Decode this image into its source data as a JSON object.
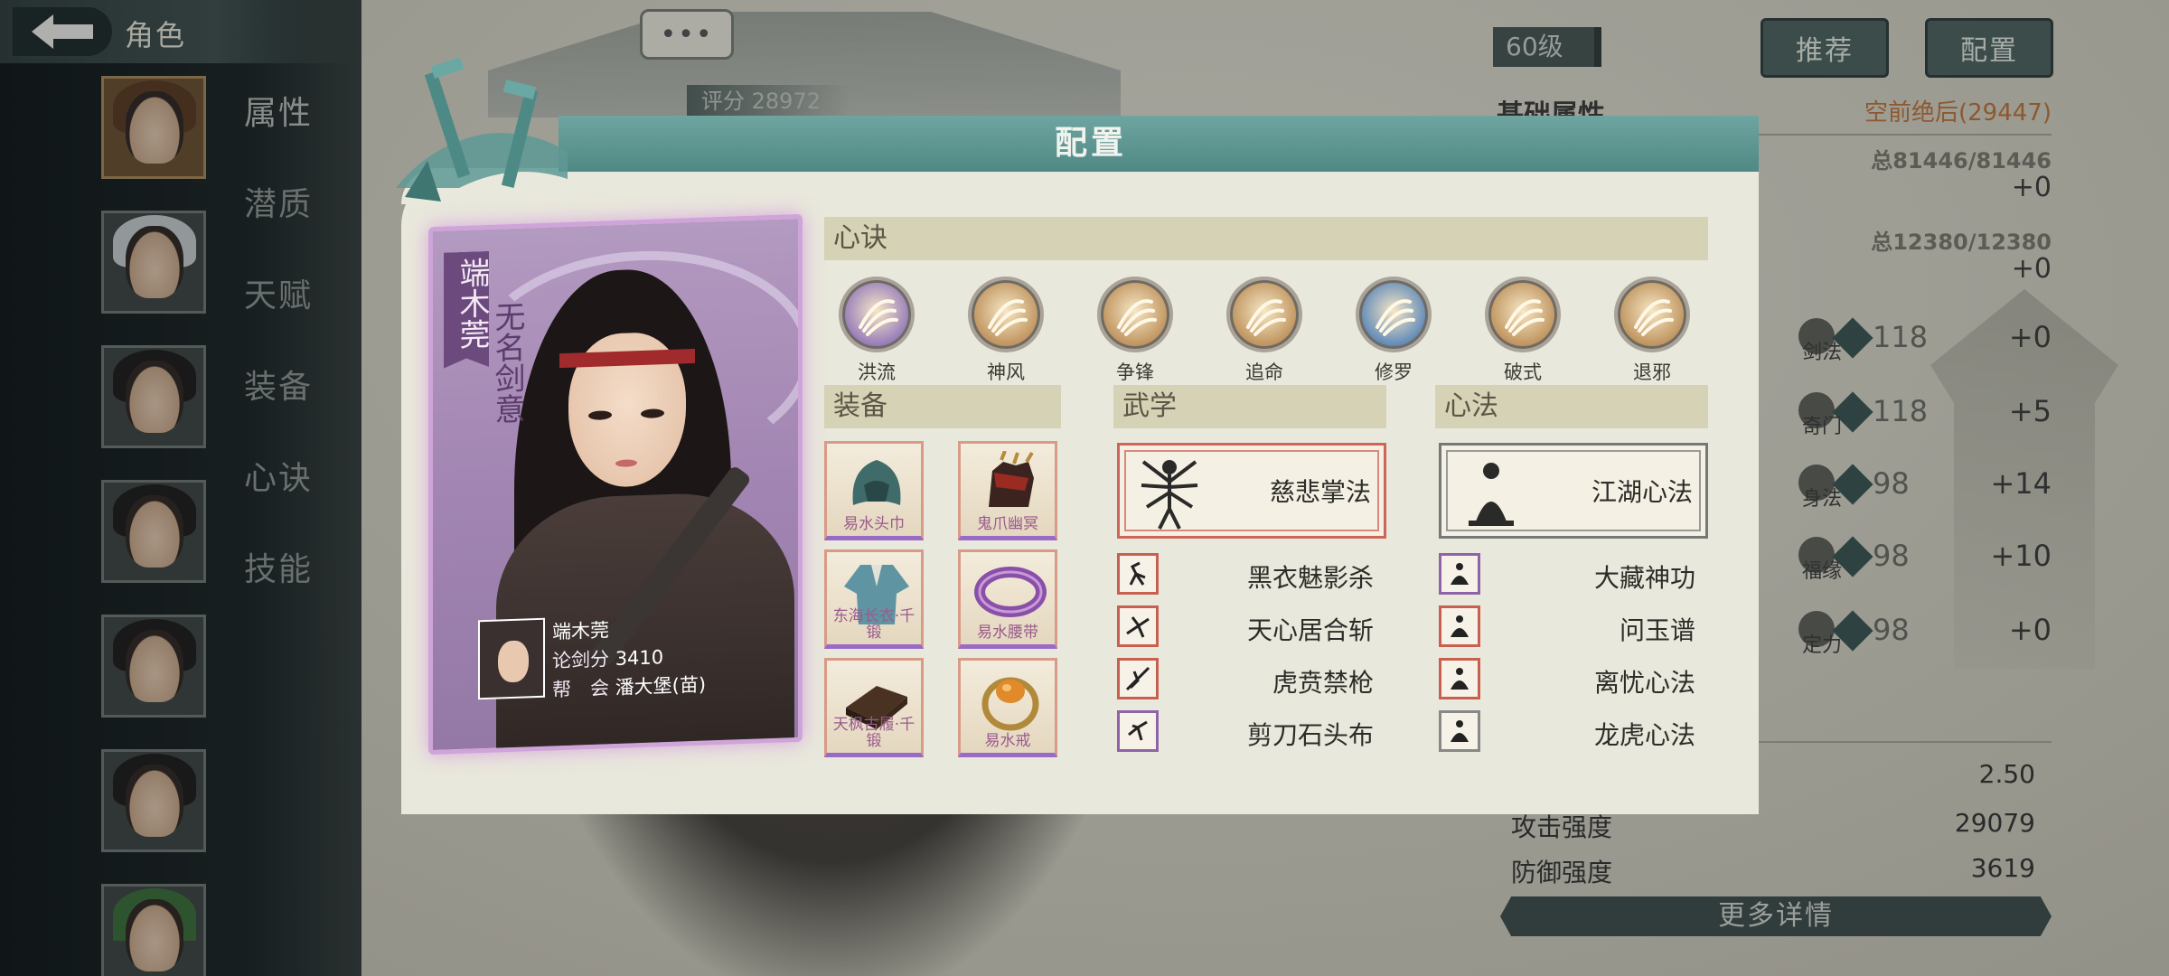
{
  "topbar": {
    "title": "角色"
  },
  "side_menu": [
    "属性",
    "潜质",
    "天赋",
    "装备",
    "心诀",
    "技能"
  ],
  "background": {
    "chat_bubble": "•••",
    "score_label": "评分",
    "score_value": "28972",
    "level": "60级",
    "recommend_button": "推荐",
    "config_button": "配置",
    "base_attr_title": "基础属性",
    "rating_text": "空前绝后(29447)",
    "hp_total": "总81446/81446",
    "hp_plus": "+0",
    "mp_total": "总12380/12380",
    "mp_plus": "+0",
    "stats": [
      {
        "label": "剑法",
        "value": "118",
        "delta": "+0"
      },
      {
        "label": "奇门",
        "value": "118",
        "delta": "+5"
      },
      {
        "label": "身法",
        "value": "98",
        "delta": "+14"
      },
      {
        "label": "福缘",
        "value": "98",
        "delta": "+10"
      },
      {
        "label": "定力",
        "value": "98",
        "delta": "+0"
      }
    ],
    "crit_value": "2.50",
    "attack_label": "攻击强度",
    "attack_value": "29079",
    "defense_label": "防御强度",
    "defense_value": "3619",
    "more_details": "更多详情"
  },
  "modal": {
    "title": "配置",
    "card": {
      "name": "端木莞",
      "title": "无名剑意",
      "info_name": "端木莞",
      "score_label": "论剑分",
      "score_value": "3410",
      "guild_label": "帮　会",
      "guild_value": "潘大堡(苗)"
    },
    "xinjue": {
      "header": "心诀",
      "items": [
        {
          "label": "洪流",
          "icon": "vortex-icon",
          "color": "#8b6fb8"
        },
        {
          "label": "神风",
          "icon": "wind-slash-icon",
          "color": "#b98a52"
        },
        {
          "label": "争锋",
          "icon": "burst-icon",
          "color": "#b98a52"
        },
        {
          "label": "追命",
          "icon": "dash-icon",
          "color": "#b98a52"
        },
        {
          "label": "修罗",
          "icon": "demon-icon",
          "color": "#4f7fb7"
        },
        {
          "label": "破式",
          "icon": "sword-break-icon",
          "color": "#b98a52"
        },
        {
          "label": "退邪",
          "icon": "scroll-icon",
          "color": "#b98a52"
        }
      ]
    },
    "equipment": {
      "header": "装备",
      "items": [
        {
          "label": "易水头巾",
          "icon": "hood-icon"
        },
        {
          "label": "鬼爪幽冥",
          "icon": "claw-glove-icon"
        },
        {
          "label": "东海长衣·千锻",
          "icon": "robe-icon"
        },
        {
          "label": "易水腰带",
          "icon": "belt-icon"
        },
        {
          "label": "天枫古履·千锻",
          "icon": "boots-icon"
        },
        {
          "label": "易水戒",
          "icon": "ring-icon"
        }
      ]
    },
    "wuxue": {
      "header": "武学",
      "main": "慈悲掌法",
      "items": [
        "黑衣魅影杀",
        "天心居合斩",
        "虎贲禁枪",
        "剪刀石头布"
      ]
    },
    "xinfa": {
      "header": "心法",
      "main": "江湖心法",
      "items": [
        "大藏神功",
        "问玉谱",
        "离忧心法",
        "龙虎心法"
      ]
    }
  }
}
